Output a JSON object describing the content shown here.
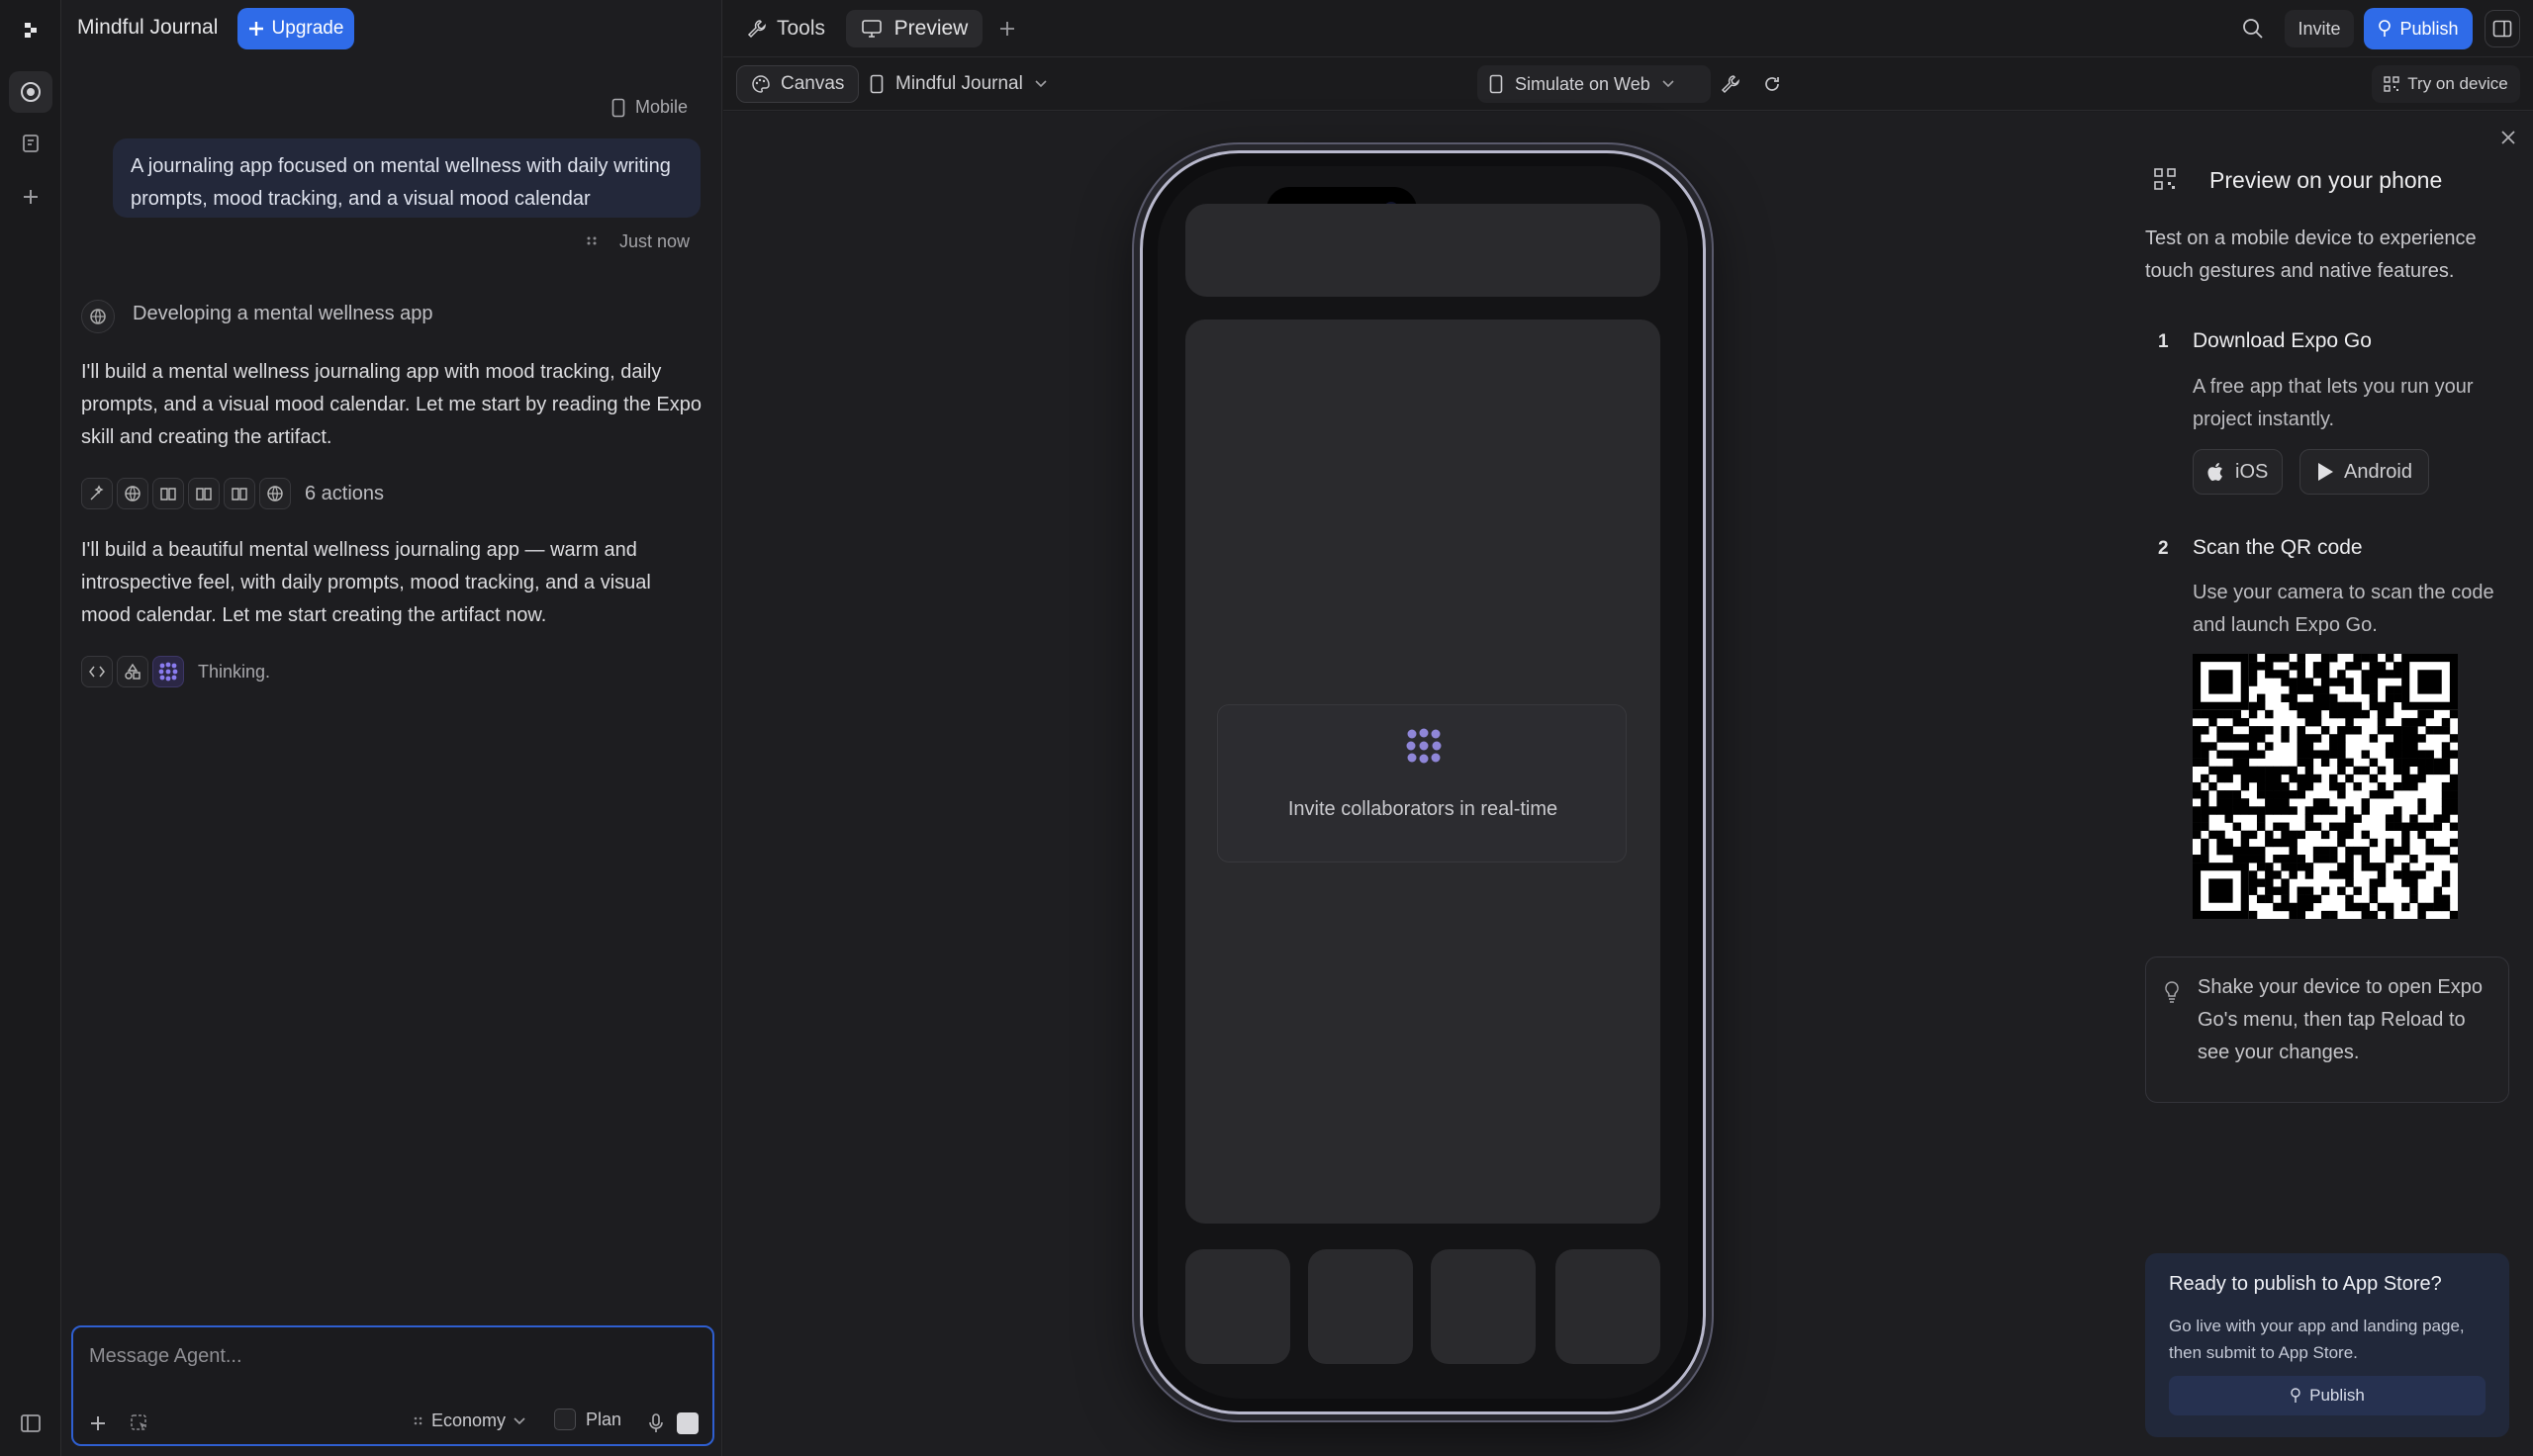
{
  "app": {
    "project_name": "Mindful Journal",
    "upgrade_label": "Upgrade"
  },
  "chat": {
    "mode_label": "Mobile",
    "user_message": "A journaling app focused on mental wellness with daily writing prompts, mood tracking, and a visual mood calendar",
    "timestamp": "Just now",
    "task_title": "Developing a mental wellness app",
    "paragraph_1": "I'll build a mental wellness journaling app with mood tracking, daily prompts, and a visual mood calendar. Let me start by reading the Expo skill and creating the artifact.",
    "actions_label": "6 actions",
    "paragraph_2": "I'll build a beautiful mental wellness journaling app — warm and introspective feel, with daily prompts, mood tracking, and a visual mood calendar. Let me start creating the artifact now.",
    "thinking_label": "Thinking."
  },
  "composer": {
    "placeholder": "Message Agent...",
    "model_label": "Economy",
    "plan_label": "Plan"
  },
  "tabs": {
    "tools_label": "Tools",
    "preview_label": "Preview"
  },
  "header_right": {
    "invite_label": "Invite",
    "publish_label": "Publish"
  },
  "subbar": {
    "canvas_label": "Canvas",
    "artifact_label": "Mindful Journal",
    "simulate_label": "Simulate on Web",
    "try_device_label": "Try on device"
  },
  "phone": {
    "card_text": "Invite collaborators in real-time"
  },
  "preview_panel": {
    "title": "Preview on your phone",
    "intro": "Test on a mobile device to experience touch gestures and native features.",
    "step1_num": "1",
    "step1_title": "Download Expo Go",
    "step1_desc": "A free app that lets you run your project instantly.",
    "ios_label": "iOS",
    "android_label": "Android",
    "step2_num": "2",
    "step2_title": "Scan the QR code",
    "step2_desc": "Use your camera to scan the code and launch Expo Go.",
    "tip": "Shake your device to open Expo Go's menu, then tap Reload to see your changes.",
    "publish_title": "Ready to publish to App Store?",
    "publish_desc": "Go live with your app and landing page, then submit to App Store.",
    "publish_button": "Publish"
  },
  "colors": {
    "accent": "#2f6be8",
    "bubble": "#23283a",
    "background": "#1c1c1e"
  }
}
